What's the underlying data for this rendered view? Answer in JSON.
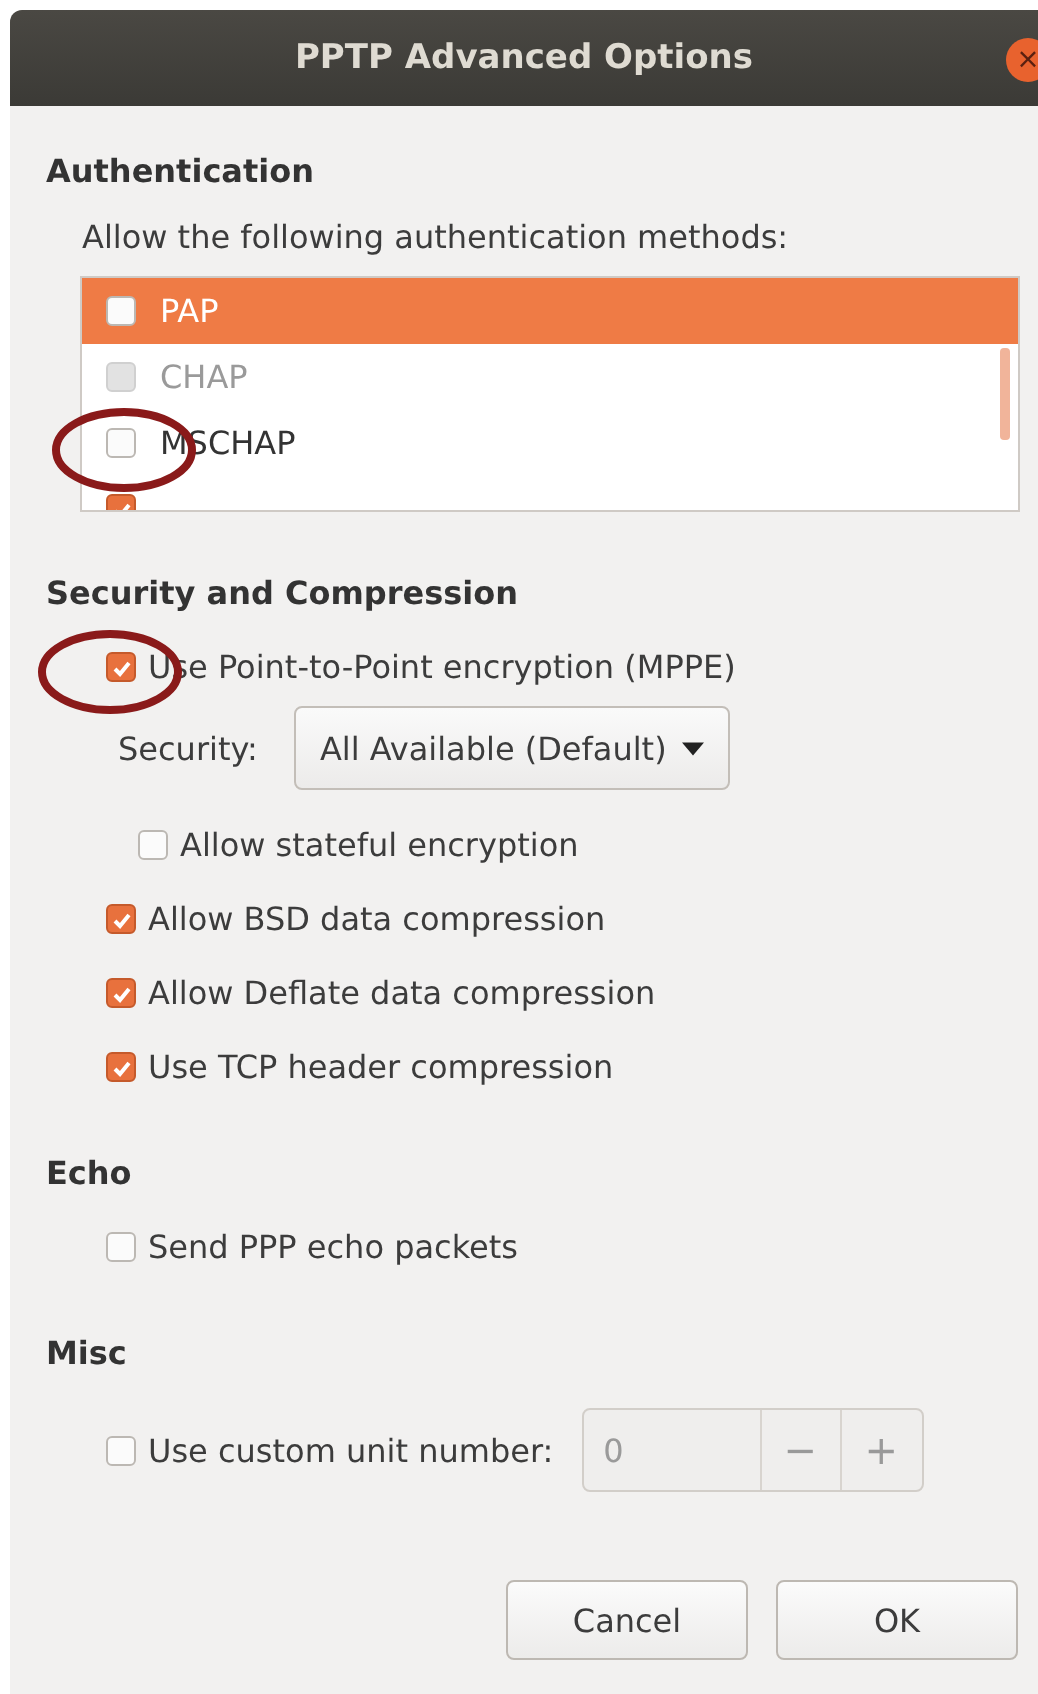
{
  "window": {
    "title": "PPTP Advanced Options",
    "close": "×"
  },
  "authentication": {
    "heading": "Authentication",
    "prompt": "Allow the following authentication methods:",
    "methods": [
      {
        "label": "PAP",
        "checked": false,
        "selected": true,
        "disabled": false
      },
      {
        "label": "CHAP",
        "checked": false,
        "selected": false,
        "disabled": true
      },
      {
        "label": "MSCHAP",
        "checked": false,
        "selected": false,
        "disabled": false
      },
      {
        "checked": true,
        "selected": false,
        "disabled": false
      }
    ]
  },
  "security": {
    "heading": "Security and Compression",
    "mppe": {
      "label": "Use Point-to-Point encryption (MPPE)",
      "checked": true
    },
    "security_label": "Security:",
    "security_value": "All Available (Default)",
    "stateful": {
      "label": "Allow stateful encryption",
      "checked": false
    },
    "options": [
      {
        "label": "Allow BSD data compression",
        "checked": true
      },
      {
        "label": "Allow Deflate data compression",
        "checked": true
      },
      {
        "label": "Use TCP header compression",
        "checked": true
      }
    ]
  },
  "echo": {
    "heading": "Echo",
    "option": {
      "label": "Send PPP echo packets",
      "checked": false
    }
  },
  "misc": {
    "heading": "Misc",
    "option": {
      "label": "Use custom unit number:",
      "checked": false
    },
    "unit_value": "0",
    "minus": "−",
    "plus": "+"
  },
  "buttons": [
    {
      "label": "Cancel"
    },
    {
      "label": "OK"
    }
  ]
}
